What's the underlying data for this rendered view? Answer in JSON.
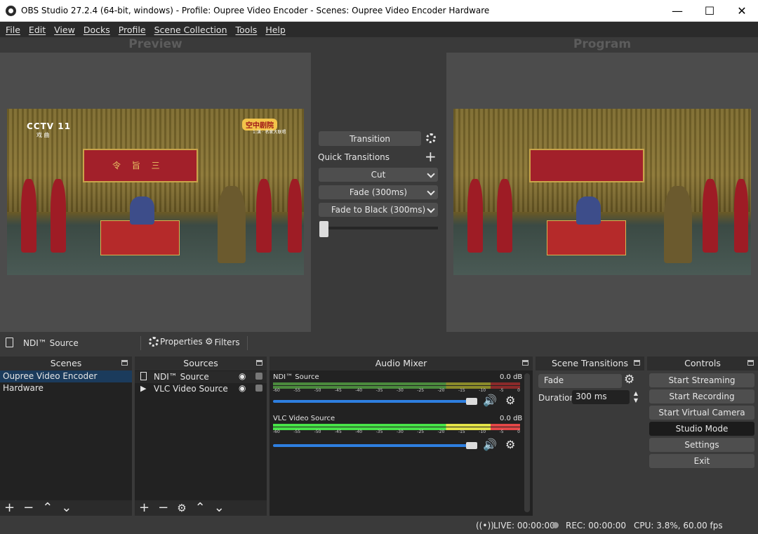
{
  "window": {
    "title": "OBS Studio 27.2.4 (64-bit, windows) - Profile: Oupree Video Encoder - Scenes: Oupree Video Encoder Hardware",
    "minimize": "—",
    "maximize": "☐",
    "close": "✕"
  },
  "menu": [
    "File",
    "Edit",
    "View",
    "Docks",
    "Profile",
    "Scene Collection",
    "Tools",
    "Help"
  ],
  "preview": {
    "label": "Preview"
  },
  "program": {
    "label": "Program"
  },
  "video": {
    "channel_logo": "CCTV 11",
    "channel_sub": "戏 曲",
    "banner": "空中剧院",
    "banner_sub": "1:演 · 名家大联唱",
    "canopy_text": "令 旨 三"
  },
  "transition": {
    "button": "Transition",
    "quick_label": "Quick Transitions",
    "items": [
      "Cut",
      "Fade (300ms)",
      "Fade to Black (300ms)"
    ],
    "tbar": 0
  },
  "source_bar": {
    "selected": "NDI™ Source",
    "properties": "Properties",
    "filters": "Filters"
  },
  "docks": {
    "scenes": {
      "title": "Scenes",
      "items": [
        "Oupree Video Encoder Hardware"
      ]
    },
    "sources": {
      "title": "Sources",
      "items": [
        "NDI™ Source",
        "VLC Video Source"
      ]
    },
    "mixer": {
      "title": "Audio Mixer",
      "channels": [
        {
          "name": "NDI™ Source",
          "db": "0.0 dB",
          "level": 0.0
        },
        {
          "name": "VLC Video Source",
          "db": "0.0 dB",
          "level": 0.97
        }
      ],
      "ticks": [
        "-60",
        "-55",
        "-50",
        "-45",
        "-40",
        "-35",
        "-30",
        "-25",
        "-20",
        "-15",
        "-10",
        "-5",
        "0"
      ]
    },
    "transitions": {
      "title": "Scene Transitions",
      "selected": "Fade",
      "duration_label": "Duration",
      "duration": "300 ms"
    },
    "controls": {
      "title": "Controls",
      "buttons": [
        "Start Streaming",
        "Start Recording",
        "Start Virtual Camera",
        "Studio Mode",
        "Settings",
        "Exit"
      ]
    }
  },
  "status": {
    "live": "LIVE: 00:00:00",
    "rec": "REC: 00:00:00",
    "cpu": "CPU: 3.8%, 60.00 fps"
  },
  "colors": {
    "accent": "#2e7fe0",
    "panel": "#3a3a3a",
    "dock": "#222222"
  }
}
